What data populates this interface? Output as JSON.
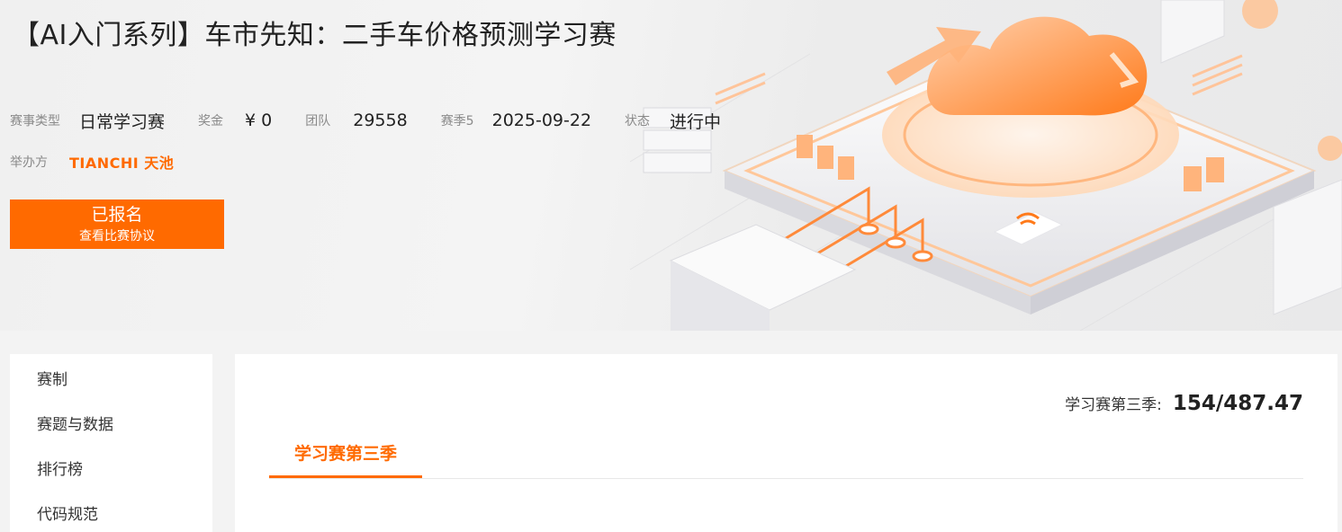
{
  "competition": {
    "title": "【AI入门系列】车市先知：二手车价格预测学习赛"
  },
  "meta": [
    {
      "label": "赛事类型",
      "value": "日常学习赛"
    },
    {
      "label": "奖金",
      "value": "¥ 0"
    },
    {
      "label": "团队",
      "value": "29558"
    },
    {
      "label": "赛季5",
      "value": "2025-09-22"
    },
    {
      "label": "状态",
      "value": "进行中"
    }
  ],
  "organizer": {
    "label": "举办方",
    "logo_text": "TIANCHI 天池"
  },
  "signup": {
    "main_label": "已报名",
    "sub_label": "查看比赛协议"
  },
  "sidebar": {
    "items": [
      {
        "label": "赛制"
      },
      {
        "label": "赛题与数据"
      },
      {
        "label": "排行榜"
      },
      {
        "label": "代码规范"
      }
    ]
  },
  "score": {
    "label": "学习赛第三季:",
    "value": "154/487.47"
  },
  "tabs": [
    {
      "label": "学习赛第三季",
      "active": true
    }
  ],
  "colors": {
    "accent": "#ff6a00",
    "background": "#f3f3f3"
  }
}
